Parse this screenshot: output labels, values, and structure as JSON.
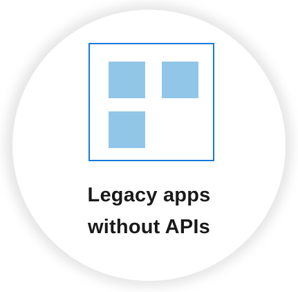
{
  "card": {
    "title_line1": "Legacy apps",
    "title_line2": "without APIs"
  },
  "icon": {
    "name": "app-grid-icon",
    "border_color": "#1479d8",
    "tile_color": "#92c6e8"
  }
}
